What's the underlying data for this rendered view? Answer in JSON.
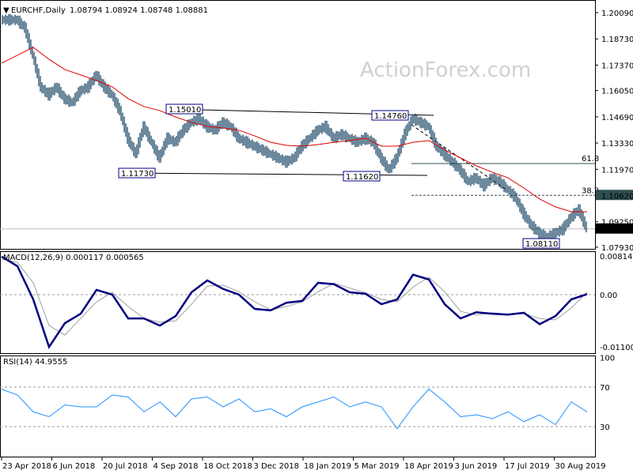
{
  "header": {
    "symbol": "EURCHF,Daily",
    "ohlc": "1.08794 1.08924 1.08748 1.08881"
  },
  "watermark": "ActionForex.com",
  "colors": {
    "bars": "#0b3a5a",
    "ma": "#e00000",
    "macd": "#000080",
    "signal": "#a0a0a0",
    "rsi": "#1e90ff",
    "label_box": "#00008b"
  },
  "chart_data": [
    {
      "type": "bar",
      "title": "EURCHF,Daily",
      "y_ticks": [
        "1.20090",
        "1.18730",
        "1.17370",
        "1.16050",
        "1.14690",
        "1.13330",
        "1.11970",
        "1.10620",
        "1.09250",
        "1.07930"
      ],
      "ylim": [
        1.0793,
        1.2009
      ],
      "x_ticks": [
        "23 Apr 2018",
        "6 Jun 2018",
        "20 Jul 2018",
        "4 Sep 2018",
        "18 Oct 2018",
        "3 Dec 2018",
        "18 Jan 2019",
        "5 Mar 2019",
        "18 Apr 2019",
        "3 Jun 2019",
        "17 Jul 2019",
        "30 Aug 2019"
      ],
      "close": [
        1.1972,
        1.1972,
        1.1972,
        1.1931,
        1.1788,
        1.1624,
        1.1583,
        1.1624,
        1.1563,
        1.1542,
        1.1604,
        1.1624,
        1.1686,
        1.1624,
        1.1583,
        1.1501,
        1.1358,
        1.1276,
        1.1419,
        1.1337,
        1.1256,
        1.1358,
        1.1337,
        1.1399,
        1.144,
        1.146,
        1.1419,
        1.1399,
        1.144,
        1.1419,
        1.1358,
        1.1337,
        1.1317,
        1.1297,
        1.1276,
        1.1256,
        1.1235,
        1.1256,
        1.1317,
        1.1358,
        1.1399,
        1.1419,
        1.1358,
        1.1378,
        1.1358,
        1.1337,
        1.1358,
        1.1337,
        1.1256,
        1.1194,
        1.1256,
        1.1378,
        1.146,
        1.144,
        1.1419,
        1.1317,
        1.1276,
        1.1235,
        1.1194,
        1.1133,
        1.1153,
        1.1112,
        1.1153,
        1.1133,
        1.1092,
        1.1051,
        1.0969,
        1.0907,
        1.0866,
        1.0846,
        1.0866,
        1.0887,
        1.0948,
        1.0989,
        1.0888
      ],
      "moving_average": [
        1.1747,
        1.1788,
        1.1829,
        1.1767,
        1.1714,
        1.1686,
        1.1657,
        1.1624,
        1.1563,
        1.1522,
        1.1501,
        1.1468,
        1.144,
        1.1419,
        1.1411,
        1.1399,
        1.137,
        1.1337,
        1.1321,
        1.1317,
        1.1325,
        1.1337,
        1.1346,
        1.1358,
        1.1317,
        1.1317,
        1.1337,
        1.1346,
        1.1297,
        1.1256,
        1.1215,
        1.1182,
        1.1153,
        1.11,
        1.1043,
        1.1002,
        1.0977,
        1.0977
      ],
      "current_price": "1.08881",
      "current_price_value": 1.08881,
      "levels": [
        {
          "label": "61.8",
          "value": 1.1227
        },
        {
          "label": "38.2",
          "value": 1.1062,
          "tag": "1.10620"
        }
      ],
      "annotations": [
        {
          "label": "1.15010",
          "value": 1.1501
        },
        {
          "label": "1.14760",
          "value": 1.1476
        },
        {
          "label": "1.11730",
          "value": 1.1173
        },
        {
          "label": "1.11620",
          "value": 1.1162
        },
        {
          "label": "1.08110",
          "value": 1.0811
        }
      ]
    },
    {
      "type": "line",
      "title": "MACD(12,26,9) 0.000117 0.000565",
      "y_ticks": [
        "0.008143",
        "0.00",
        "-0.011007"
      ],
      "ylim": [
        -0.011007,
        0.008143
      ],
      "macd": [
        0.008,
        0.006,
        -0.001,
        -0.011,
        -0.006,
        -0.004,
        0.001,
        0.0,
        -0.005,
        -0.005,
        -0.0065,
        -0.0045,
        0.0005,
        0.003,
        0.0012,
        0.0,
        -0.003,
        -0.0033,
        -0.0017,
        -0.0013,
        0.0025,
        0.0022,
        0.0005,
        0.0002,
        -0.002,
        -0.001,
        0.0042,
        0.0032,
        -0.002,
        -0.005,
        -0.0037,
        -0.004,
        -0.0042,
        -0.0038,
        -0.0062,
        -0.0045,
        -0.001,
        0.000117
      ],
      "signal": [
        0.0075,
        0.0068,
        0.0025,
        -0.0065,
        -0.0085,
        -0.005,
        -0.0015,
        0.0005,
        -0.0025,
        -0.005,
        -0.0058,
        -0.0055,
        -0.002,
        0.0018,
        0.002,
        0.0006,
        -0.0015,
        -0.0032,
        -0.0025,
        -0.0015,
        0.0006,
        0.0024,
        0.0014,
        0.0004,
        -0.001,
        -0.0015,
        0.0016,
        0.0037,
        0.0006,
        -0.0035,
        -0.0043,
        -0.0038,
        -0.0041,
        -0.004,
        -0.005,
        -0.0053,
        -0.0028,
        0.000565
      ]
    },
    {
      "type": "line",
      "title": "RSI(14) 44.9555",
      "y_ticks": [
        "100",
        "70",
        "30"
      ],
      "ylim": [
        0,
        100
      ],
      "levels": [
        70,
        30
      ],
      "rsi": [
        68,
        62,
        45,
        40,
        52,
        50,
        50,
        62,
        60,
        45,
        55,
        40,
        58,
        60,
        50,
        58,
        45,
        48,
        40,
        50,
        55,
        60,
        50,
        55,
        50,
        28,
        50,
        68,
        55,
        40,
        42,
        38,
        45,
        35,
        42,
        32,
        55,
        44.9555
      ]
    }
  ]
}
